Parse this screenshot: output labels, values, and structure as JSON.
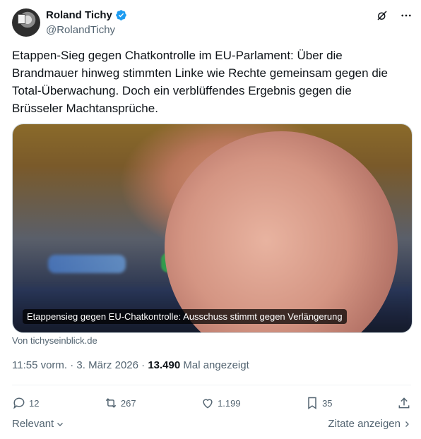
{
  "author": {
    "name": "Roland Tichy",
    "handle": "@RolandTichy",
    "verified": true
  },
  "tweet": {
    "text": "Etappen-Sieg gegen Chatkontrolle im EU-Parlament: Über die\nBrandmauer hinweg stimmten Linke wie Rechte gemeinsam gegen die\nTotal-Überwachung.  Doch ein verblüffendes Ergebnis gegen die\nBrüsseler Machtansprüche."
  },
  "card": {
    "caption": "Etappensieg gegen EU-Chatkontrolle: Ausschuss stimmt gegen Verlängerung",
    "source": "Von tichyseinblick.de"
  },
  "meta": {
    "time_date": "11:55 vorm. · 3. März 2026 · ",
    "views": "13.490",
    "views_label": " Mal angezeigt"
  },
  "actions": {
    "replies": "12",
    "reposts": "267",
    "likes": "1.199",
    "bookmarks": "35"
  },
  "footer": {
    "sort_label": "Relevant",
    "quotes_link": "Zitate anzeigen"
  },
  "icons": {
    "verified_color": "#1d9bf0",
    "grok": "grok-icon",
    "more": "more-icon"
  }
}
